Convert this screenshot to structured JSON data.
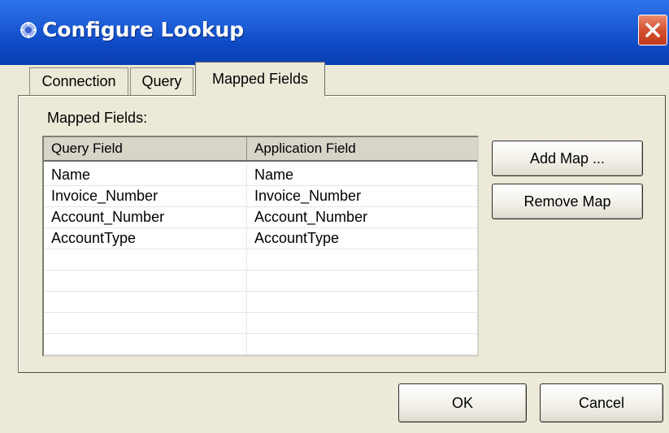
{
  "window": {
    "title": "Configure Lookup",
    "icon": "gear-app-icon",
    "close_icon": "close-icon"
  },
  "tabs": [
    {
      "label": "Connection",
      "selected": false
    },
    {
      "label": "Query",
      "selected": false
    },
    {
      "label": "Mapped Fields",
      "selected": true
    }
  ],
  "panel": {
    "label": "Mapped Fields:"
  },
  "grid": {
    "columns": [
      "Query Field",
      "Application Field"
    ],
    "rows": [
      {
        "query": "Name",
        "app": "Name"
      },
      {
        "query": "Invoice_Number",
        "app": "Invoice_Number"
      },
      {
        "query": "Account_Number",
        "app": "Account_Number"
      },
      {
        "query": "AccountType",
        "app": "AccountType"
      },
      {
        "query": "",
        "app": ""
      },
      {
        "query": "",
        "app": ""
      },
      {
        "query": "",
        "app": ""
      },
      {
        "query": "",
        "app": ""
      },
      {
        "query": "",
        "app": ""
      },
      {
        "query": "",
        "app": ""
      }
    ]
  },
  "buttons": {
    "add_map": "Add Map ...",
    "remove_map": "Remove Map",
    "ok": "OK",
    "cancel": "Cancel"
  },
  "colors": {
    "titlebar": "#0d49c4",
    "close": "#d4502f",
    "window_bg": "#ece9d8"
  }
}
